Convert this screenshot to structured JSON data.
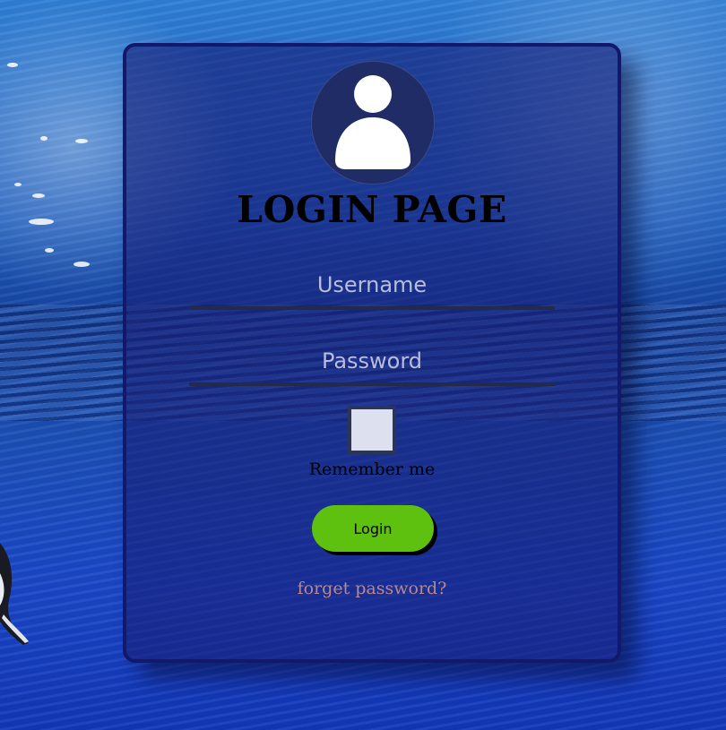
{
  "page": {
    "title": "LOGIN PAGE"
  },
  "login_form": {
    "avatar_icon": "user-icon",
    "username_placeholder": "Username",
    "password_placeholder": "Password",
    "remember_label": "Remember me",
    "remember_checked": false,
    "login_label": "Login",
    "forgot_label": "forget password?"
  },
  "colors": {
    "card_border": "#12186a",
    "login_button": "#5ec00f",
    "forgot_link": "#b7888e",
    "avatar_bg": "#1f2c66"
  }
}
